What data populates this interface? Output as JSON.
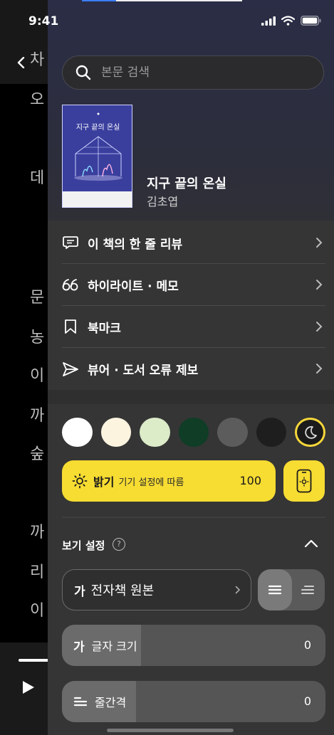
{
  "status_bar": {
    "time": "9:41"
  },
  "reader": {
    "visible_chars": [
      "차",
      "오",
      "데",
      "문",
      "농",
      "이",
      "까",
      "숲",
      "까",
      "리",
      "이"
    ]
  },
  "search": {
    "placeholder": "본문 검색"
  },
  "book": {
    "cover_title": "지구 끝의 온실",
    "title": "지구 끝의 온실",
    "author": "김초엽"
  },
  "menu": {
    "items": [
      {
        "label": "이 책의 한 줄 리뷰",
        "icon": "comment-icon"
      },
      {
        "label": "하이라이트 · 메모",
        "icon": "quote-icon"
      },
      {
        "label": "북마크",
        "icon": "bookmark-icon"
      },
      {
        "label": "뷰어 · 도서 오류 제보",
        "icon": "send-icon"
      }
    ]
  },
  "themes": {
    "colors": [
      "#ffffff",
      "#fdf4e0",
      "#dcebc8",
      "#0f3d26",
      "#5c5c5c",
      "#1e1e1e"
    ],
    "selected": "night-mode-icon"
  },
  "brightness": {
    "label": "밝기",
    "sub_label": "기기 설정에 따름",
    "value": 100,
    "value_fraction": 1.0
  },
  "view_settings": {
    "title": "보기 설정",
    "help": "?",
    "font": {
      "prefix": "가",
      "name": "전자책 원본"
    },
    "font_size": {
      "prefix": "가",
      "label": "글자 크기",
      "value": "0",
      "level_fraction": 0.3
    },
    "line_spacing": {
      "label": "줄간격",
      "value": "0",
      "level_fraction": 0.28
    }
  },
  "colors": {
    "accent": "#f7dc32",
    "panel": "#353535",
    "header_bg": "#2a2d45"
  }
}
